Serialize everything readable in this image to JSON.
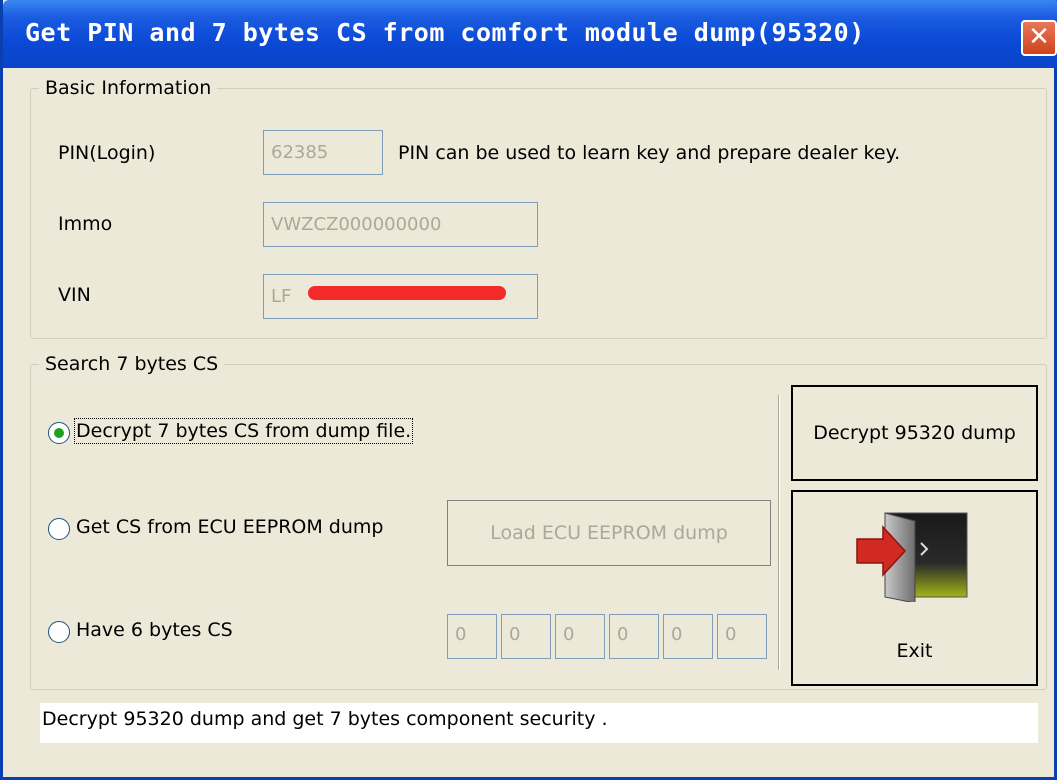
{
  "window": {
    "title": "Get PIN and 7 bytes CS from comfort module dump(95320)",
    "close_glyph": "✕"
  },
  "basic_info": {
    "legend": "Basic Information",
    "pin_label": "PIN(Login)",
    "pin_value": "62385",
    "pin_note": "PIN can be used to learn key and prepare dealer key.",
    "immo_label": "Immo",
    "immo_value": "VWZCZ000000000",
    "vin_label": "VIN",
    "vin_value": "LF"
  },
  "search": {
    "legend": "Search 7 bytes CS",
    "option_decrypt": "Decrypt 7 bytes CS from dump file.",
    "option_ecu": "Get CS from ECU EEPROM dump",
    "option_six": "Have 6 bytes CS",
    "selected_option": "decrypt",
    "load_ecu_button": "Load ECU EEPROM dump",
    "cs_bytes": [
      "0",
      "0",
      "0",
      "0",
      "0",
      "0"
    ]
  },
  "actions": {
    "decrypt_button": "Decrypt 95320 dump",
    "exit_button": "Exit",
    "exit_icon": "exit-door-icon"
  },
  "status": {
    "message": "Decrypt 95320 dump and get 7 bytes component security ."
  },
  "colors": {
    "titlebar": "#0b4ad6",
    "window_bg": "#ece9d8",
    "radio_dot": "#21a121",
    "exit_arrow": "#d12a22"
  }
}
